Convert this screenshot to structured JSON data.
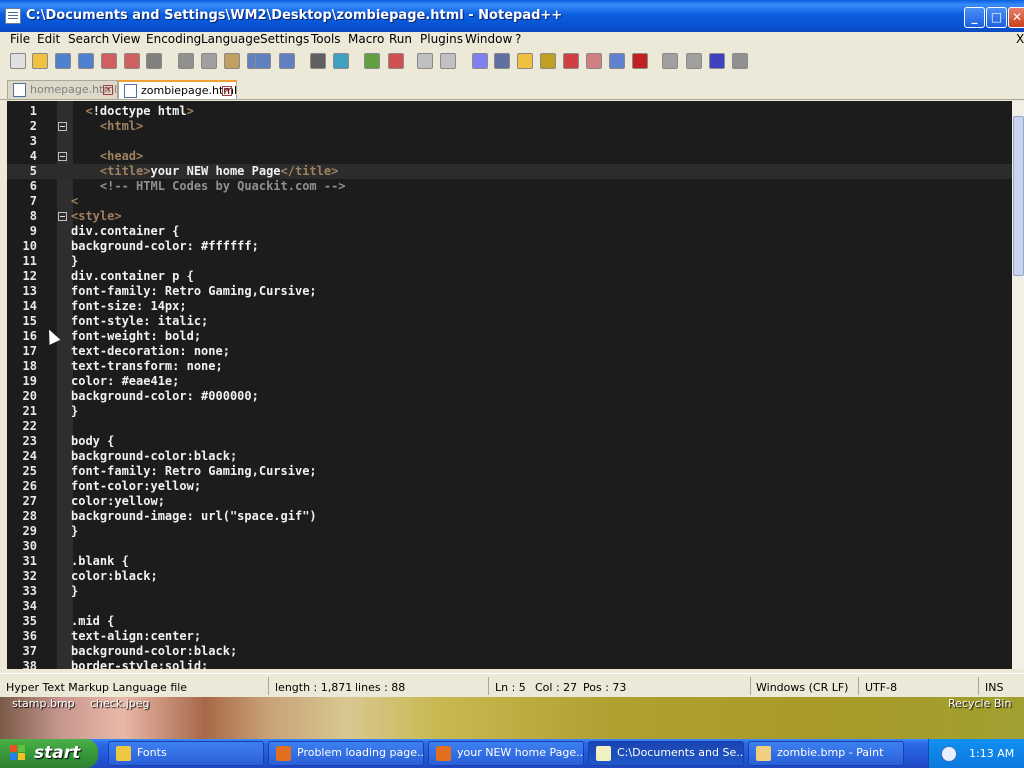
{
  "window": {
    "title": "C:\\Documents and Settings\\WM2\\Desktop\\zombiepage.html - Notepad++",
    "minimize": "_",
    "maximize": "□",
    "close": "✕"
  },
  "menu": [
    "File",
    "Edit",
    "Search",
    "View",
    "Encoding",
    "Language",
    "Settings",
    "Tools",
    "Macro",
    "Run",
    "Plugins",
    "Window",
    "?"
  ],
  "menu_close": "X",
  "toolbar_icons": [
    "new-file-icon",
    "open-file-icon",
    "save-icon",
    "save-all-icon",
    "close-icon",
    "close-all-icon",
    "print-icon",
    "cut-icon",
    "copy-icon",
    "paste-icon",
    "undo-icon",
    "redo-icon",
    "find-icon",
    "replace-icon",
    "zoom-in-icon",
    "zoom-out-icon",
    "sync-vertical-icon",
    "sync-horizontal-icon",
    "word-wrap-icon",
    "show-all-characters-icon",
    "indent-guide-icon",
    "user-language-icon",
    "function-list-icon",
    "doc-map-icon",
    "folder-icon",
    "monitoring-icon",
    "record-macro-icon",
    "stop-macro-icon",
    "play-macro-icon",
    "run-macro-multiple-icon",
    "save-macro-icon"
  ],
  "tabs": {
    "inactive": "homepage.html",
    "active": "zombiepage.html"
  },
  "code_lines": [
    {
      "n": "1",
      "pre": "  <",
      "tag": "!doctype html>",
      "post": "",
      "cur": false
    },
    {
      "n": "2",
      "text": "    <html>",
      "kind": "tag",
      "fold": true
    },
    {
      "n": "3",
      "text": "",
      "kind": "plain"
    },
    {
      "n": "4",
      "text": "    <head>",
      "kind": "tag",
      "fold": true
    },
    {
      "n": "5",
      "text": "    <title>your NEW home Page</title>",
      "kind": "title",
      "cur": true
    },
    {
      "n": "6",
      "text": "    <!-- HTML Codes by Quackit.com -->",
      "kind": "comment"
    },
    {
      "n": "7",
      "text": "<",
      "kind": "tag"
    },
    {
      "n": "8",
      "text": "<style>",
      "kind": "tag",
      "fold": true
    },
    {
      "n": "9",
      "text": "div.container {",
      "kind": "plain"
    },
    {
      "n": "10",
      "text": "background-color: #ffffff;",
      "kind": "plain"
    },
    {
      "n": "11",
      "text": "}",
      "kind": "plain"
    },
    {
      "n": "12",
      "text": "div.container p {",
      "kind": "plain"
    },
    {
      "n": "13",
      "text": "font-family: Retro Gaming,Cursive;",
      "kind": "plain"
    },
    {
      "n": "14",
      "text": "font-size: 14px;",
      "kind": "plain"
    },
    {
      "n": "15",
      "text": "font-style: italic;",
      "kind": "plain"
    },
    {
      "n": "16",
      "text": "font-weight: bold;",
      "kind": "plain"
    },
    {
      "n": "17",
      "text": "text-decoration: none;",
      "kind": "plain"
    },
    {
      "n": "18",
      "text": "text-transform: none;",
      "kind": "plain"
    },
    {
      "n": "19",
      "text": "color: #eae41e;",
      "kind": "plain"
    },
    {
      "n": "20",
      "text": "background-color: #000000;",
      "kind": "plain"
    },
    {
      "n": "21",
      "text": "}",
      "kind": "plain"
    },
    {
      "n": "22",
      "text": "",
      "kind": "plain"
    },
    {
      "n": "23",
      "text": "body {",
      "kind": "plain"
    },
    {
      "n": "24",
      "text": "background-color:black;",
      "kind": "plain"
    },
    {
      "n": "25",
      "text": "font-family: Retro Gaming,Cursive;",
      "kind": "plain"
    },
    {
      "n": "26",
      "text": "font-color:yellow;",
      "kind": "plain"
    },
    {
      "n": "27",
      "text": "color:yellow;",
      "kind": "plain"
    },
    {
      "n": "28",
      "text": "background-image: url(\"space.gif\")",
      "kind": "plain"
    },
    {
      "n": "29",
      "text": "}",
      "kind": "plain"
    },
    {
      "n": "30",
      "text": "",
      "kind": "plain"
    },
    {
      "n": "31",
      "text": ".blank {",
      "kind": "plain"
    },
    {
      "n": "32",
      "text": "color:black;",
      "kind": "plain"
    },
    {
      "n": "33",
      "text": "}",
      "kind": "plain"
    },
    {
      "n": "34",
      "text": "",
      "kind": "plain"
    },
    {
      "n": "35",
      "text": ".mid {",
      "kind": "plain"
    },
    {
      "n": "36",
      "text": "text-align:center;",
      "kind": "plain"
    },
    {
      "n": "37",
      "text": "background-color:black;",
      "kind": "plain"
    },
    {
      "n": "38",
      "text": "border-style:solid;",
      "kind": "plain"
    }
  ],
  "status": {
    "filetype": "Hyper Text Markup Language file",
    "length": "length : 1,871",
    "lines": "lines : 88",
    "ln": "Ln : 5",
    "col": "Col : 27",
    "pos": "Pos : 73",
    "eol": "Windows (CR LF)",
    "encoding": "UTF-8",
    "mode": "INS"
  },
  "desktop_icons": [
    "stamp.bmp",
    "check.jpeg",
    "Recycle Bin"
  ],
  "taskbar": {
    "start": "start",
    "tasks": [
      {
        "label": "Fonts",
        "color": "#f0c840"
      },
      {
        "label": "Problem loading page...",
        "color": "#e07020"
      },
      {
        "label": "your NEW home Page...",
        "color": "#e07020"
      },
      {
        "label": "C:\\Documents and Se...",
        "color": "#f0f0c0",
        "active": true
      },
      {
        "label": "zombie.bmp - Paint",
        "color": "#f0d080"
      }
    ],
    "clock": "1:13 AM"
  }
}
